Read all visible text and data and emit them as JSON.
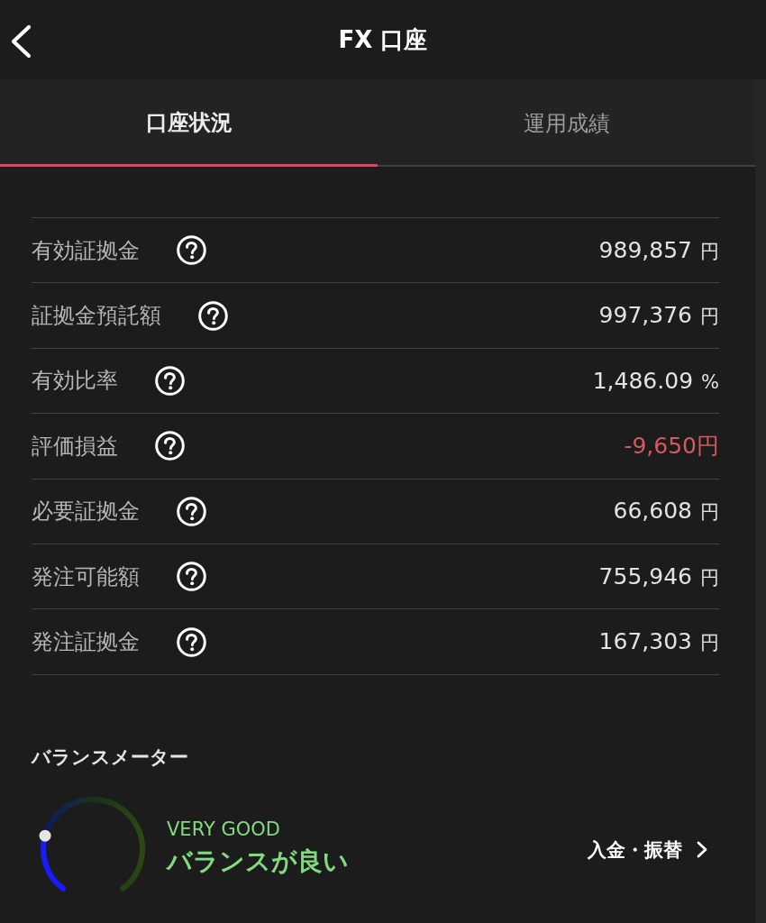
{
  "header": {
    "title": "FX 口座"
  },
  "tabs": [
    {
      "label": "口座状況",
      "selected": true
    },
    {
      "label": "運用成績",
      "selected": false
    }
  ],
  "account_rows": [
    {
      "label": "有効証拠金",
      "value": "989,857",
      "unit": "円",
      "negative": false
    },
    {
      "label": "証拠金預託額",
      "value": "997,376",
      "unit": "円",
      "negative": false
    },
    {
      "label": "有効比率",
      "value": "1,486.09",
      "unit": "%",
      "negative": false
    },
    {
      "label": "評価損益",
      "value": "-9,650円",
      "negative": true
    },
    {
      "label": "必要証拠金",
      "value": "66,608",
      "unit": "円",
      "negative": false
    },
    {
      "label": "発注可能額",
      "value": "755,946",
      "unit": "円",
      "negative": false
    },
    {
      "label": "発注証拠金",
      "value": "167,303",
      "unit": "円",
      "negative": false
    }
  ],
  "balance_meter": {
    "title": "バランスメーター",
    "level": 0.24,
    "rating": "VERY GOOD",
    "message": "バランスが良い"
  },
  "deposit_link": {
    "label": "入金・振替"
  }
}
